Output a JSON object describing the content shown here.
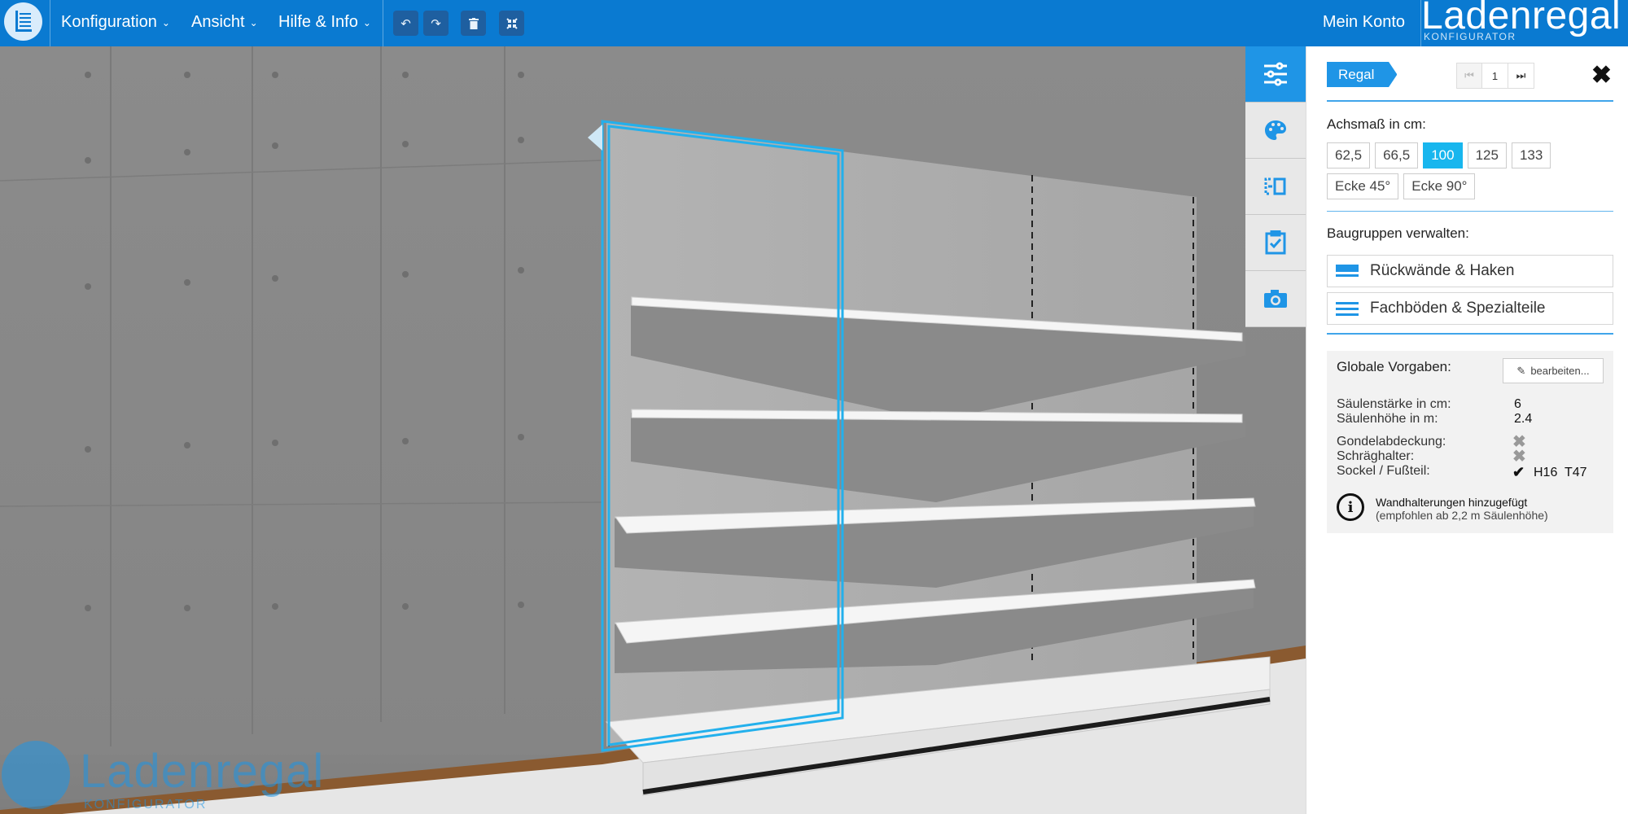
{
  "header": {
    "menus": [
      {
        "label": "Konfiguration"
      },
      {
        "label": "Ansicht"
      },
      {
        "label": "Hilfe & Info"
      }
    ],
    "toolbar_icons": [
      "undo-icon",
      "redo-icon",
      "trash-icon",
      "compress-icon"
    ],
    "account_label": "Mein Konto",
    "brand_name": "Ladenregal",
    "brand_sub": "KONFIGURATOR"
  },
  "scene": {
    "watermark_name": "Ladenregal",
    "watermark_sub": "KONFIGURATOR",
    "side_tools": [
      "sliders-icon",
      "palette-icon",
      "mirror-icon",
      "clipboard-check-icon",
      "camera-icon"
    ],
    "active_tool": "sliders-icon"
  },
  "panel": {
    "tag": "Regal",
    "page_number": "1",
    "axis_label": "Achsmaß in cm:",
    "axis_options": [
      "62,5",
      "66,5",
      "100",
      "125",
      "133"
    ],
    "axis_selected": "100",
    "corner_options": [
      "Ecke 45°",
      "Ecke 90°"
    ],
    "groups_label": "Baugruppen verwalten:",
    "groups": [
      {
        "label": "Rückwände & Haken",
        "icon": "backwall-icon"
      },
      {
        "label": "Fachböden & Spezialteile",
        "icon": "shelves-icon"
      }
    ],
    "globals": {
      "title": "Globale Vorgaben:",
      "edit_label": "bearbeiten...",
      "column_strength_label": "Säulenstärke in cm:",
      "column_strength_value": "6",
      "column_height_label": "Säulenhöhe in m:",
      "column_height_value": "2.4",
      "gondola_cover_label": "Gondelabdeckung:",
      "slant_holder_label": "Schräghalter:",
      "base_label": "Sockel / Fußteil:",
      "base_h": "H16",
      "base_t": "T47",
      "info_title": "Wandhalterungen hinzugefügt",
      "info_sub": "(empfohlen ab 2,2 m Säulenhöhe)"
    }
  },
  "colors": {
    "header_blue": "#0a7ad1",
    "accent_blue": "#1f95e6",
    "selected_cyan": "#18b6ee"
  }
}
